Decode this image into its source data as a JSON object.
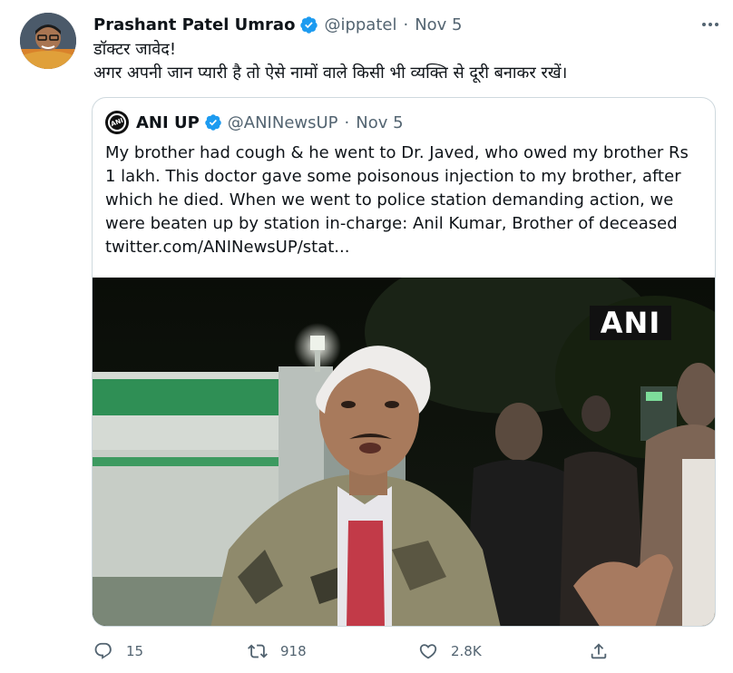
{
  "tweet": {
    "author": {
      "display_name": "Prashant Patel Umrao",
      "handle": "@ippatel",
      "verified": true
    },
    "separator": "·",
    "date": "Nov 5",
    "text_lines": [
      "डॉक्टर जावेद!",
      "अगर अपनी जान प्यारी है तो ऐसे नामों वाले किसी भी व्यक्ति से दूरी बनाकर रखें।"
    ],
    "quoted": {
      "display_name": "ANI UP",
      "handle": "@ANINewsUP",
      "verified": true,
      "separator": "·",
      "date": "Nov 5",
      "text_lines": [
        "My brother had cough & he went to Dr. Javed, who owed my brother Rs",
        "1 lakh. This doctor gave some poisonous injection to my brother, after",
        "which he died. When we went to police station demanding action, we",
        "were beaten up by station in-charge: Anil Kumar, Brother of deceased",
        "twitter.com/ANINewsUP/stat..."
      ],
      "media_watermark": "ANI",
      "avatar_logo_text": "ANI"
    },
    "actions": {
      "replies": "15",
      "retweets": "918",
      "likes": "2.8K"
    }
  },
  "colors": {
    "verified_blue": "#1d9bf0",
    "secondary_text": "#536471",
    "border": "#cfd9de"
  },
  "icons": {
    "more": "more-dots-icon",
    "reply": "reply-icon",
    "retweet": "retweet-icon",
    "like": "like-icon",
    "share": "share-icon",
    "verified": "verified-badge-icon"
  }
}
